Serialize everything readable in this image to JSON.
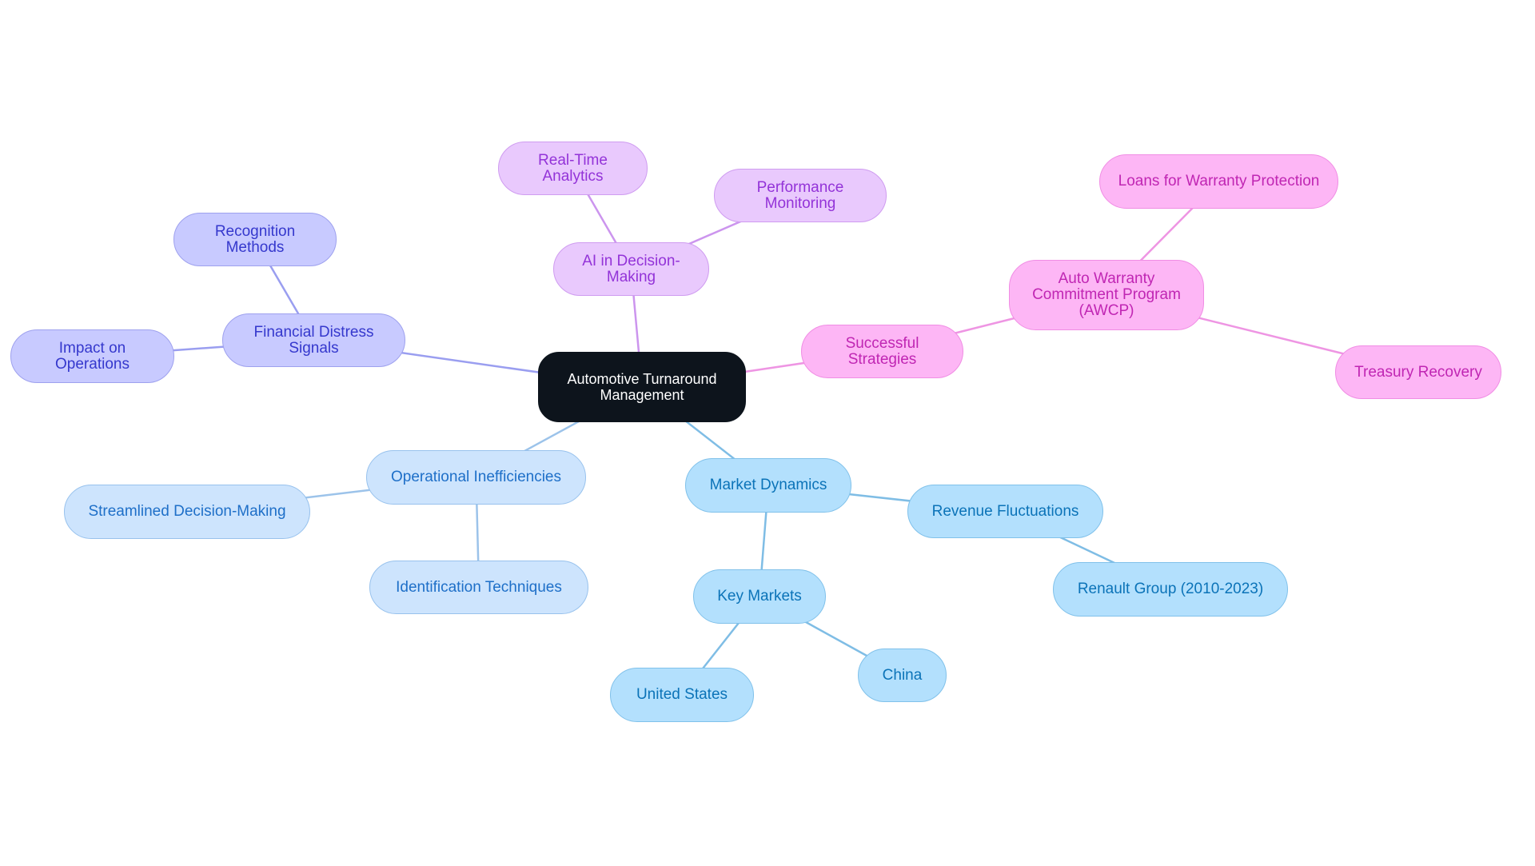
{
  "title": "Automotive Turnaround Management",
  "palette": {
    "root": {
      "fill": "#0d141c",
      "border": "#0d141c",
      "text": "#ffffff",
      "edge": "#000000"
    },
    "indigo": {
      "fill": "#c8caff",
      "border": "#9ea1ee",
      "text": "#3538cd",
      "edge": "#9a9ef0"
    },
    "purple": {
      "fill": "#e9c9fd",
      "border": "#cf9cf0",
      "text": "#9333d8",
      "edge": "#cc95ee"
    },
    "pink": {
      "fill": "#fdb6f5",
      "border": "#f08de4",
      "text": "#c026b3",
      "edge": "#ee95e3"
    },
    "light": {
      "fill": "#cde4fd",
      "border": "#98c2ed",
      "text": "#1e6fc8",
      "edge": "#9cc3ea"
    },
    "sky": {
      "fill": "#b3e0fd",
      "border": "#80c1ea",
      "text": "#0b73b8",
      "edge": "#7fbde5"
    }
  },
  "nodes": [
    {
      "id": "root",
      "label": "Automotive Turnaround Management",
      "branch": "root"
    },
    {
      "id": "financial-distress-signals",
      "label": "Financial Distress Signals",
      "branch": "indigo",
      "parent": "root"
    },
    {
      "id": "recognition-methods",
      "label": "Recognition Methods",
      "branch": "indigo",
      "parent": "financial-distress-signals"
    },
    {
      "id": "impact-on-operations",
      "label": "Impact on Operations",
      "branch": "indigo",
      "parent": "financial-distress-signals"
    },
    {
      "id": "ai-in-decision-making",
      "label": "AI in Decision-Making",
      "branch": "purple",
      "parent": "root"
    },
    {
      "id": "real-time-analytics",
      "label": "Real-Time Analytics",
      "branch": "purple",
      "parent": "ai-in-decision-making"
    },
    {
      "id": "performance-monitoring",
      "label": "Performance Monitoring",
      "branch": "purple",
      "parent": "ai-in-decision-making"
    },
    {
      "id": "successful-strategies",
      "label": "Successful Strategies",
      "branch": "pink",
      "parent": "root"
    },
    {
      "id": "awcp",
      "label": "Auto Warranty Commitment Program (AWCP)",
      "branch": "pink",
      "parent": "successful-strategies"
    },
    {
      "id": "loans-for-warranty-protection",
      "label": "Loans for Warranty Protection",
      "branch": "pink",
      "parent": "awcp"
    },
    {
      "id": "treasury-recovery",
      "label": "Treasury Recovery",
      "branch": "pink",
      "parent": "awcp"
    },
    {
      "id": "operational-inefficiencies",
      "label": "Operational Inefficiencies",
      "branch": "light",
      "parent": "root"
    },
    {
      "id": "streamlined-decision-making",
      "label": "Streamlined Decision-Making",
      "branch": "light",
      "parent": "operational-inefficiencies"
    },
    {
      "id": "identification-techniques",
      "label": "Identification Techniques",
      "branch": "light",
      "parent": "operational-inefficiencies"
    },
    {
      "id": "market-dynamics",
      "label": "Market Dynamics",
      "branch": "sky",
      "parent": "root"
    },
    {
      "id": "revenue-fluctuations",
      "label": "Revenue Fluctuations",
      "branch": "sky",
      "parent": "market-dynamics"
    },
    {
      "id": "renault-group",
      "label": "Renault Group (2010-2023)",
      "branch": "sky",
      "parent": "revenue-fluctuations"
    },
    {
      "id": "key-markets",
      "label": "Key Markets",
      "branch": "sky",
      "parent": "market-dynamics"
    },
    {
      "id": "united-states",
      "label": "United States",
      "branch": "sky",
      "parent": "key-markets"
    },
    {
      "id": "china",
      "label": "China",
      "branch": "sky",
      "parent": "key-markets"
    }
  ]
}
